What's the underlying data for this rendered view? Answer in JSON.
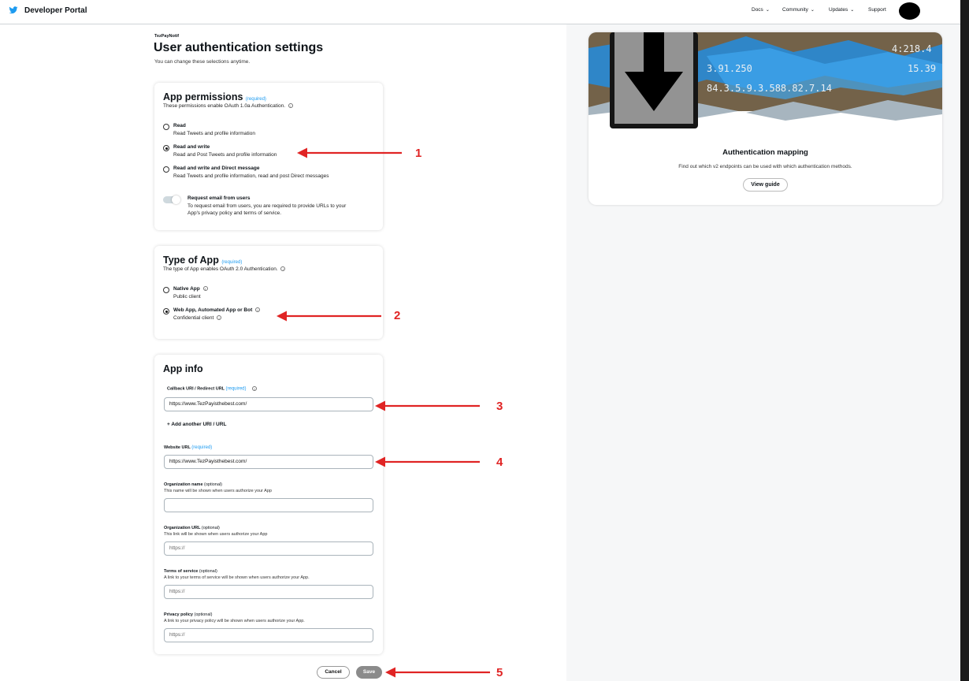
{
  "header": {
    "brand": "Developer Portal",
    "nav": [
      "Docs",
      "Community",
      "Updates"
    ],
    "support": "Support"
  },
  "page": {
    "app_name": "TezPayNotif",
    "title": "User authentication settings",
    "subtitle": "You can change these selections anytime."
  },
  "permissions": {
    "title": "App permissions",
    "required": "(required)",
    "desc": "These permissions enable OAuth 1.0a Authentication.",
    "options": [
      {
        "label": "Read",
        "sub": "Read Tweets and profile information",
        "selected": false
      },
      {
        "label": "Read and write",
        "sub": "Read and Post Tweets and profile information",
        "selected": true
      },
      {
        "label": "Read and write and Direct message",
        "sub": "Read Tweets and profile information, read and post Direct messages",
        "selected": false
      }
    ],
    "email_toggle": {
      "label": "Request email from users",
      "line1": "To request email from users, you are required to provide URLs to your",
      "line2": "App's privacy policy and terms of service.",
      "on": false
    }
  },
  "app_type": {
    "title": "Type of App",
    "required": "(required)",
    "desc": "The type of App enables OAuth 2.0 Authentication.",
    "options": [
      {
        "label": "Native App",
        "sub": "Public client",
        "selected": false
      },
      {
        "label": "Web App, Automated App or Bot",
        "sub": "Confidential client",
        "selected": true
      }
    ]
  },
  "app_info": {
    "title": "App info",
    "callback_label": "Callback URI / Redirect URL",
    "callback_required": "(required)",
    "callback_value": "https://www.TezPayisthebest.com/",
    "add_uri": "+ Add another URI / URL",
    "website_label": "Website URL",
    "website_required": "(required)",
    "website_value": "https://www.TezPayisthebest.com/",
    "org_name_label": "Organization name",
    "org_name_opt": "(optional)",
    "org_name_help": "This name will be shown when users authorize your App",
    "org_name_value": "",
    "org_url_label": "Organization URL",
    "org_url_opt": "(optional)",
    "org_url_help": "This link will be shown when users authorize your App",
    "org_url_placeholder": "https://",
    "tos_label": "Terms of service",
    "tos_opt": "(optional)",
    "tos_help": "A link to your terms of service will be shown when users authorize your App.",
    "tos_placeholder": "https://",
    "privacy_label": "Privacy policy",
    "privacy_opt": "(optional)",
    "privacy_help": "A link to your privacy policy will be shown when users authorize your App.",
    "privacy_placeholder": "https://"
  },
  "actions": {
    "cancel": "Cancel",
    "save": "Save"
  },
  "guide": {
    "title": "Authentication mapping",
    "subtitle": "Find out which v2 endpoints can be used with which authentication methods.",
    "button": "View guide",
    "art_text_1": "3.91.250",
    "art_text_2": "84.3.5.9.3.588.82.7.14",
    "art_text_3": "4:218.4",
    "art_text_4": "15.39"
  },
  "annotations": [
    "1",
    "2",
    "3",
    "4",
    "5"
  ],
  "colors": {
    "accent": "#1d9bf0",
    "annotation": "#e02424",
    "save_disabled": "#8b8b8b"
  }
}
